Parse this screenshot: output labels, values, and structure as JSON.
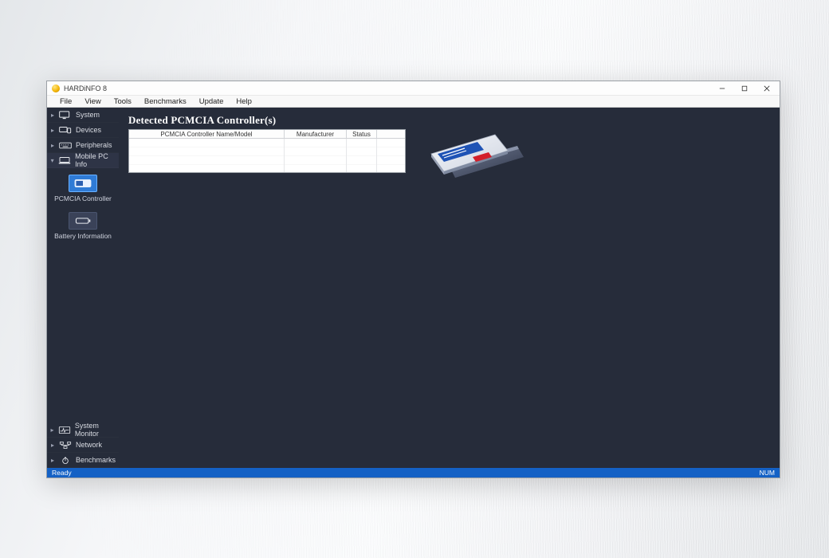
{
  "app": {
    "title": "HARDiNFO 8"
  },
  "window_controls": {
    "minimize": "minimize",
    "maximize": "maximize",
    "close": "close"
  },
  "menubar": [
    "File",
    "View",
    "Tools",
    "Benchmarks",
    "Update",
    "Help"
  ],
  "sidebar": {
    "top_groups": [
      {
        "label": "System",
        "expanded": false
      },
      {
        "label": "Devices",
        "expanded": false
      },
      {
        "label": "Peripherals",
        "expanded": false
      },
      {
        "label": "Mobile PC Info",
        "expanded": true
      }
    ],
    "mobile_items": [
      {
        "label": "PCMCIA Controller",
        "selected": true
      },
      {
        "label": "Battery Information",
        "selected": false
      }
    ],
    "bottom_groups": [
      {
        "label": "System Monitor"
      },
      {
        "label": "Network"
      },
      {
        "label": "Benchmarks"
      }
    ]
  },
  "content": {
    "panel_title": "Detected PCMCIA Controller(s)",
    "columns": [
      "PCMCIA Controller Name/Model",
      "Manufacturer",
      "Status",
      ""
    ],
    "rows": []
  },
  "statusbar": {
    "left": "Ready",
    "right": "NUM"
  }
}
